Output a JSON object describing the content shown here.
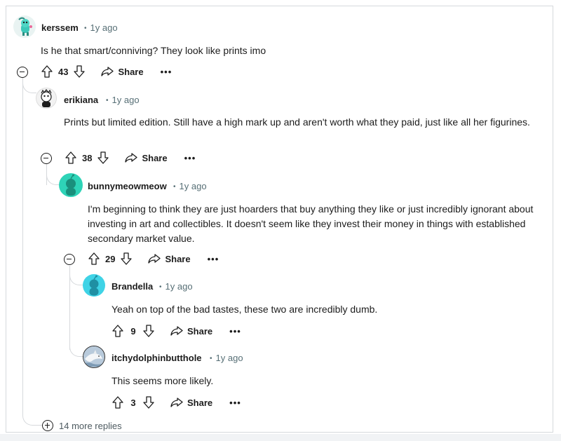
{
  "comments": [
    {
      "author": "kerssem",
      "time": "1y ago",
      "body": "Is he that smart/conniving? They look like prints imo",
      "votes": "43",
      "share_label": "Share",
      "more_label": "•••"
    },
    {
      "author": "erikiana",
      "time": "1y ago",
      "body": "Prints but limited edition. Still have a high mark up and aren't worth what they paid, just like all her figurines.",
      "votes": "38",
      "share_label": "Share",
      "more_label": "•••"
    },
    {
      "author": "bunnymeowmeow",
      "time": "1y ago",
      "body": "I'm beginning to think they are just hoarders that buy anything they like or just incredibly ignorant about investing in art and collectibles. It doesn't seem like they invest their money in things with established secondary market value.",
      "votes": "29",
      "share_label": "Share",
      "more_label": "•••"
    },
    {
      "author": "Brandella",
      "time": "1y ago",
      "body": "Yeah on top of the bad tastes, these two are incredibly dumb.",
      "votes": "9",
      "share_label": "Share",
      "more_label": "•••"
    },
    {
      "author": "itchydolphinbutthole",
      "time": "1y ago",
      "body": "This seems more likely.",
      "votes": "3",
      "share_label": "Share",
      "more_label": "•••"
    }
  ],
  "more_replies_label": "14 more replies",
  "colors": {
    "text": "#1c1c1c",
    "meta": "#576f76",
    "thread_line": "#d6d9dc",
    "avatar_teal": "#2ed3b7",
    "avatar_cyan": "#3fd3e6"
  },
  "icons": [
    "upvote-icon",
    "downvote-icon",
    "share-icon",
    "collapse-icon",
    "expand-icon",
    "snoo-avatar-icon"
  ]
}
